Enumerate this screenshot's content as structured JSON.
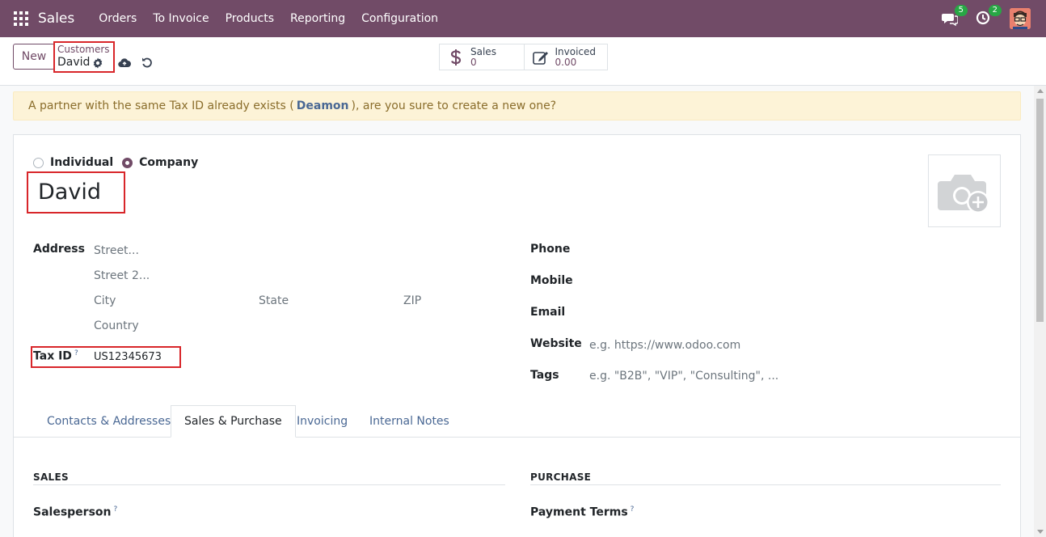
{
  "navbar": {
    "brand": "Sales",
    "menu": [
      "Orders",
      "To Invoice",
      "Products",
      "Reporting",
      "Configuration"
    ],
    "messages_count": "5",
    "activities_count": "2"
  },
  "control_panel": {
    "new_label": "New",
    "breadcrumb_parent": "Customers",
    "breadcrumb_current": "David",
    "stats": [
      {
        "label": "Sales",
        "value": "0",
        "icon": "dollar-icon"
      },
      {
        "label": "Invoiced",
        "value": "0.00",
        "icon": "edit-icon"
      }
    ]
  },
  "alert": {
    "text_before": "A partner with the same Tax ID already exists (",
    "link": "Deamon",
    "text_after": "), are you sure to create a new one?"
  },
  "form": {
    "type_options": [
      "Individual",
      "Company"
    ],
    "selected_type": "Company",
    "name": "David",
    "address_label": "Address",
    "street_placeholder": "Street...",
    "street2_placeholder": "Street 2...",
    "city_placeholder": "City",
    "state_placeholder": "State",
    "zip_placeholder": "ZIP",
    "country_placeholder": "Country",
    "tax_id_label": "Tax ID",
    "tax_id_help": "?",
    "tax_id_value": "US12345673",
    "phone_label": "Phone",
    "mobile_label": "Mobile",
    "email_label": "Email",
    "website_label": "Website",
    "website_placeholder": "e.g. https://www.odoo.com",
    "tags_label": "Tags",
    "tags_placeholder": "e.g. \"B2B\", \"VIP\", \"Consulting\", ..."
  },
  "tabs": [
    "Contacts & Addresses",
    "Sales & Purchase",
    "Invoicing",
    "Internal Notes"
  ],
  "active_tab": "Sales & Purchase",
  "sales_section": {
    "title": "SALES",
    "salesperson_label": "Salesperson",
    "help": "?"
  },
  "purchase_section": {
    "title": "PURCHASE",
    "payment_terms_label": "Payment Terms",
    "help": "?"
  },
  "colors": {
    "brand": "#714b67",
    "alert_bg": "#fdf3d7",
    "highlight": "#d8262a",
    "link": "#4a6894"
  }
}
